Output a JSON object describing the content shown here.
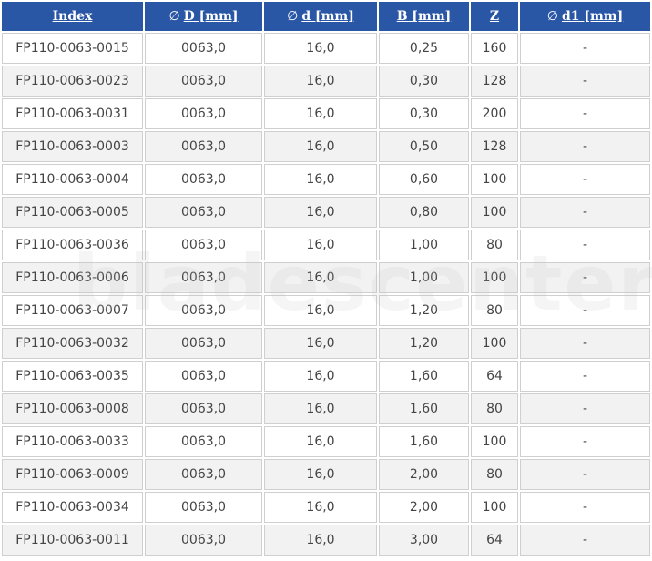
{
  "headers": {
    "index": "Index",
    "outer_diameter": "D [mm]",
    "bore": "d [mm]",
    "width": "B [mm]",
    "teeth": "Z",
    "d1": "d1 [mm]",
    "diameter_symbol": "∅"
  },
  "watermark": "bladescenter",
  "rows": [
    {
      "index": "FP110-0063-0015",
      "D": "0063,0",
      "d": "16,0",
      "B": "0,25",
      "Z": "160",
      "d1": "-"
    },
    {
      "index": "FP110-0063-0023",
      "D": "0063,0",
      "d": "16,0",
      "B": "0,30",
      "Z": "128",
      "d1": "-"
    },
    {
      "index": "FP110-0063-0031",
      "D": "0063,0",
      "d": "16,0",
      "B": "0,30",
      "Z": "200",
      "d1": "-"
    },
    {
      "index": "FP110-0063-0003",
      "D": "0063,0",
      "d": "16,0",
      "B": "0,50",
      "Z": "128",
      "d1": "-"
    },
    {
      "index": "FP110-0063-0004",
      "D": "0063,0",
      "d": "16,0",
      "B": "0,60",
      "Z": "100",
      "d1": "-"
    },
    {
      "index": "FP110-0063-0005",
      "D": "0063,0",
      "d": "16,0",
      "B": "0,80",
      "Z": "100",
      "d1": "-"
    },
    {
      "index": "FP110-0063-0036",
      "D": "0063,0",
      "d": "16,0",
      "B": "1,00",
      "Z": "80",
      "d1": "-"
    },
    {
      "index": "FP110-0063-0006",
      "D": "0063,0",
      "d": "16,0",
      "B": "1,00",
      "Z": "100",
      "d1": "-"
    },
    {
      "index": "FP110-0063-0007",
      "D": "0063,0",
      "d": "16,0",
      "B": "1,20",
      "Z": "80",
      "d1": "-"
    },
    {
      "index": "FP110-0063-0032",
      "D": "0063,0",
      "d": "16,0",
      "B": "1,20",
      "Z": "100",
      "d1": "-"
    },
    {
      "index": "FP110-0063-0035",
      "D": "0063,0",
      "d": "16,0",
      "B": "1,60",
      "Z": "64",
      "d1": "-"
    },
    {
      "index": "FP110-0063-0008",
      "D": "0063,0",
      "d": "16,0",
      "B": "1,60",
      "Z": "80",
      "d1": "-"
    },
    {
      "index": "FP110-0063-0033",
      "D": "0063,0",
      "d": "16,0",
      "B": "1,60",
      "Z": "100",
      "d1": "-"
    },
    {
      "index": "FP110-0063-0009",
      "D": "0063,0",
      "d": "16,0",
      "B": "2,00",
      "Z": "80",
      "d1": "-"
    },
    {
      "index": "FP110-0063-0034",
      "D": "0063,0",
      "d": "16,0",
      "B": "2,00",
      "Z": "100",
      "d1": "-"
    },
    {
      "index": "FP110-0063-0011",
      "D": "0063,0",
      "d": "16,0",
      "B": "3,00",
      "Z": "64",
      "d1": "-"
    }
  ]
}
